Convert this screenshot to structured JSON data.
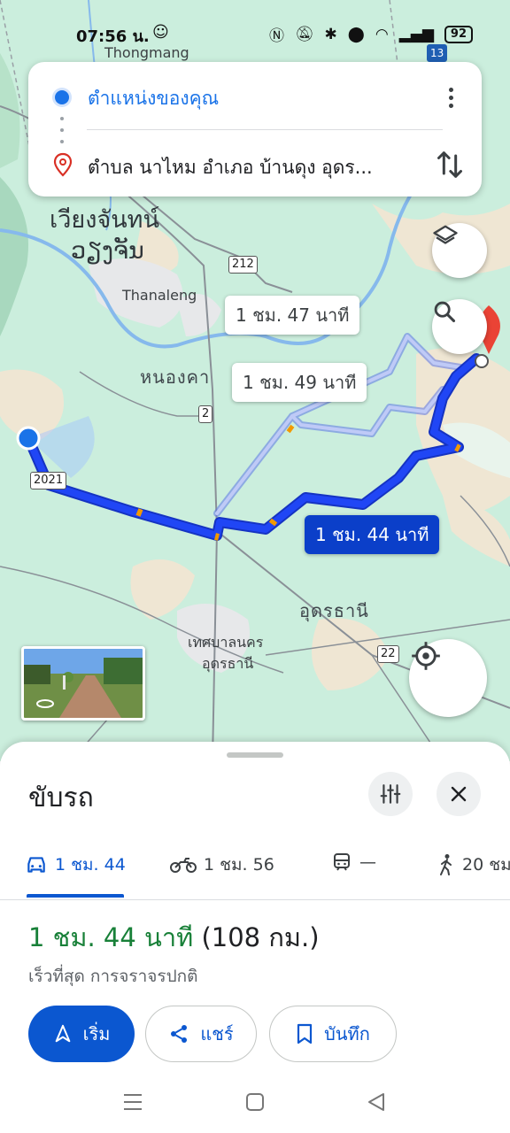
{
  "status_bar": {
    "time": "07:56 น.",
    "battery": "92"
  },
  "route_search": {
    "origin": "ตำแหน่งของคุณ",
    "destination": "ตำบล นาไหม อำเภอ บ้านดุง อุดร..."
  },
  "map": {
    "labels": {
      "thongmang": "Thongmang",
      "vientiane_thai": "เวียงจันทน์",
      "vientiane_lao": "ວຽງຈັນ",
      "thanaleng": "Thanaleng",
      "nong_khai": "หนองคา",
      "udon": "อุดรธานี",
      "udon_city_1": "เทศบาลนคร",
      "udon_city_2": "อุดรธานี"
    },
    "road_shields": {
      "r13": "13",
      "r212": "212",
      "r2": "2",
      "r2021": "2021",
      "r22": "22"
    },
    "route_bubbles": {
      "alt1": "1 ชม. 47 นาที",
      "alt2": "1 ชม. 49 นาที",
      "main": "1 ชม. 44 นาที"
    }
  },
  "sheet": {
    "title": "ขับรถ",
    "modes": [
      {
        "name": "car",
        "label": "1 ชม. 44"
      },
      {
        "name": "motorcycle",
        "label": "1 ชม. 56"
      },
      {
        "name": "transit",
        "label": "—"
      },
      {
        "name": "walk",
        "label": "20 ชม"
      }
    ],
    "duration": "1 ชม. 44 นาที",
    "distance": "(108 กม.)",
    "subtitle": "เร็วที่สุด การจราจรปกติ",
    "buttons": {
      "start": "เริ่ม",
      "share": "แชร์",
      "save": "บันทึก"
    }
  },
  "colors": {
    "route_blue": "#1a3ff0",
    "route_alt": "#a9b8f5",
    "accent": "#0b57d0",
    "green": "#188038"
  }
}
